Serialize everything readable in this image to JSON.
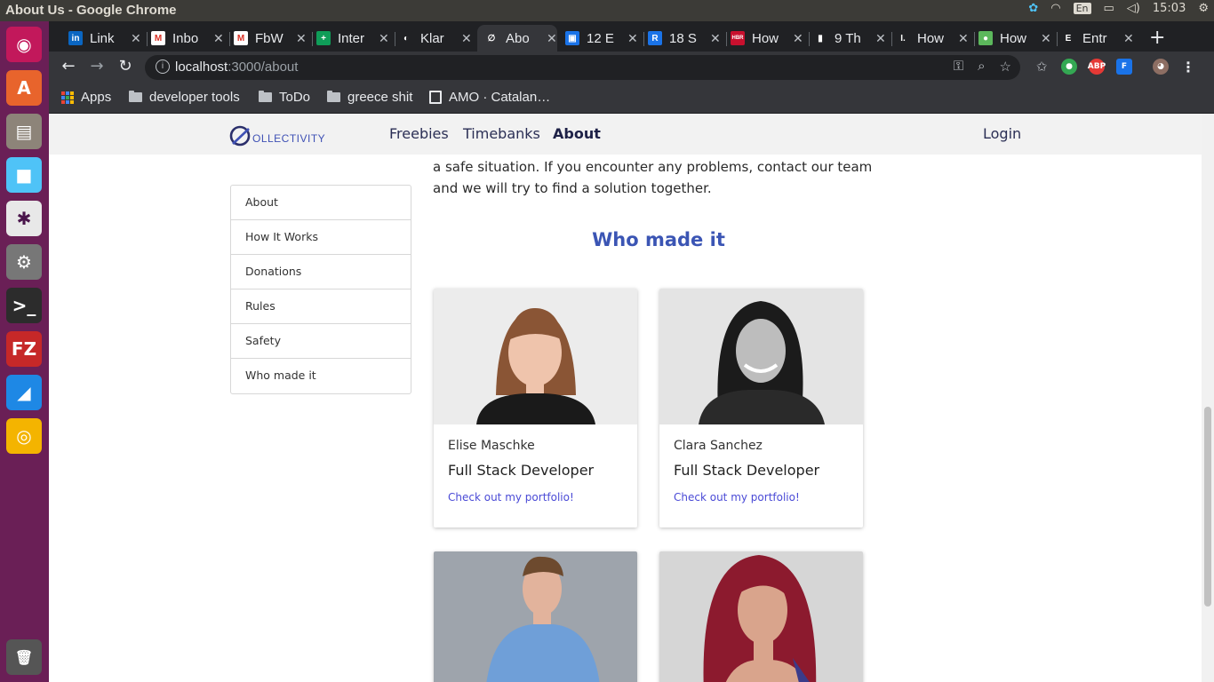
{
  "os": {
    "window_title": "About Us - Google Chrome",
    "lang": "En",
    "clock": "15:03"
  },
  "launcher": [
    {
      "name": "ubuntu-dash-icon",
      "color": "#c2185b",
      "glyph": "◉"
    },
    {
      "name": "software-center-icon",
      "color": "#e8642c",
      "glyph": "A"
    },
    {
      "name": "files-icon",
      "color": "#8d8479",
      "glyph": "▤"
    },
    {
      "name": "app-cube-icon",
      "color": "#4fc3f7",
      "glyph": "■"
    },
    {
      "name": "slack-icon",
      "color": "#e8e8e8",
      "glyph": "✱"
    },
    {
      "name": "settings-icon",
      "color": "#777",
      "glyph": "⚙"
    },
    {
      "name": "terminal-icon",
      "color": "#2c2c2c",
      "glyph": ">_"
    },
    {
      "name": "filezilla-icon",
      "color": "#c62828",
      "glyph": "FZ"
    },
    {
      "name": "vscode-icon",
      "color": "#1e88e5",
      "glyph": "◢"
    },
    {
      "name": "chrome-icon",
      "color": "#f4b400",
      "glyph": "◎"
    }
  ],
  "tabs": [
    {
      "label": "Link",
      "fav_color": "#0a66c2",
      "fav_text": "in"
    },
    {
      "label": "Inbo",
      "fav_color": "#ffffff",
      "fav_text": "M"
    },
    {
      "label": "FbW",
      "fav_color": "#ffffff",
      "fav_text": "M"
    },
    {
      "label": "Inter",
      "fav_color": "#0f9d58",
      "fav_text": "+"
    },
    {
      "label": "Klar",
      "fav_color": "#202124",
      "fav_text": "◐"
    },
    {
      "label": "Abo",
      "fav_color": "#35363a",
      "fav_text": "∅",
      "active": true
    },
    {
      "label": "12 E",
      "fav_color": "#1a73e8",
      "fav_text": "▣"
    },
    {
      "label": "18 S",
      "fav_color": "#1a73e8",
      "fav_text": "R"
    },
    {
      "label": "How",
      "fav_color": "#c8102e",
      "fav_text": "HBR"
    },
    {
      "label": "9 Th",
      "fav_color": "#202124",
      "fav_text": "▮"
    },
    {
      "label": "How",
      "fav_color": "#202124",
      "fav_text": "I."
    },
    {
      "label": "How",
      "fav_color": "#5cb85c",
      "fav_text": "●"
    },
    {
      "label": "Entr",
      "fav_color": "#202124",
      "fav_text": "E"
    }
  ],
  "toolbar": {
    "url_host": "localhost",
    "url_path": ":3000/about"
  },
  "bookmarks": {
    "apps": "Apps",
    "items": [
      "developer tools",
      "ToDo",
      "greece shit"
    ],
    "amo": "AMO · Catalan…"
  },
  "site": {
    "logo_text": "OLLECTIVITY",
    "nav": {
      "freebies": "Freebies",
      "timebanks": "Timebanks",
      "about": "About",
      "login": "Login"
    },
    "intro": "a safe situation. If you encounter any problems, contact our team and we will try to find a solution together.",
    "menu": [
      "About",
      "How It Works",
      "Donations",
      "Rules",
      "Safety",
      "Who made it"
    ],
    "who_heading": "Who made it",
    "cards": [
      {
        "name": "Elise Maschke",
        "role": "Full Stack Developer",
        "link": "Check out my portfolio!"
      },
      {
        "name": "Clara Sanchez",
        "role": "Full Stack Developer",
        "link": "Check out my portfolio!"
      }
    ]
  }
}
